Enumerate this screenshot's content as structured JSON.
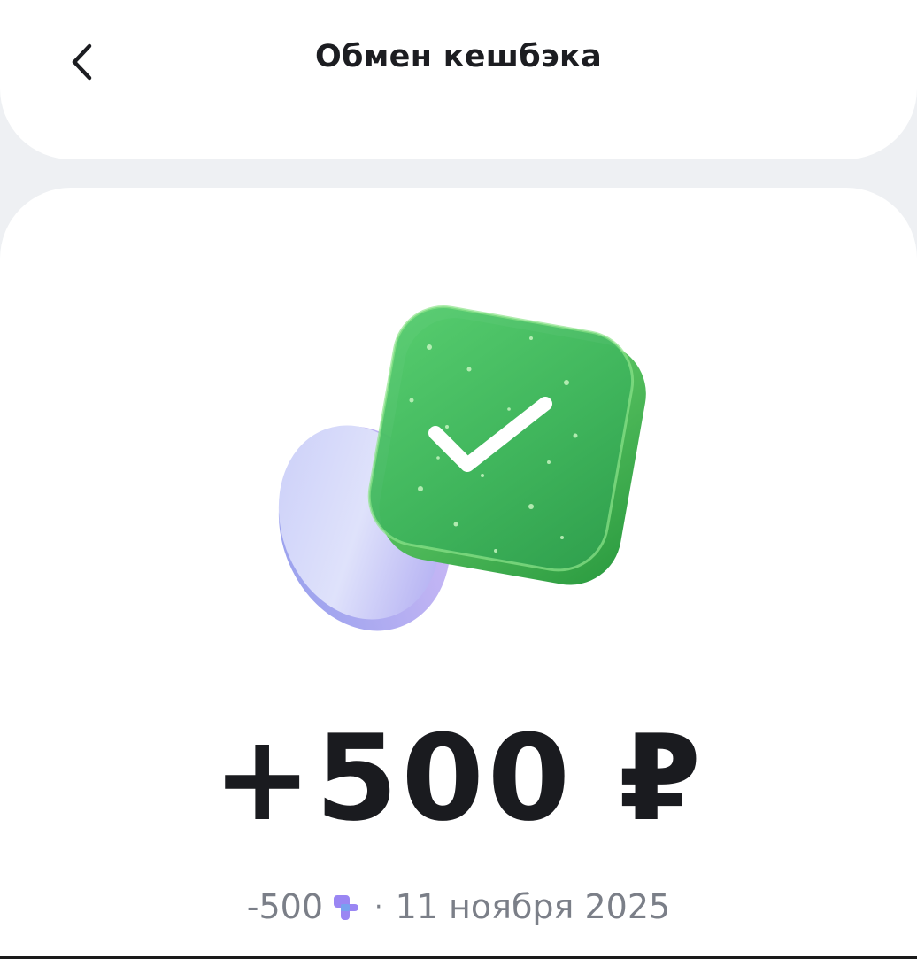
{
  "header": {
    "title": "Обмен кешбэка",
    "back_icon": "chevron-left-icon"
  },
  "illustration": {
    "icon": "success-check-badge-icon",
    "badge_color": "#3dbb5a",
    "coin_color": "#b8bdf5"
  },
  "transaction": {
    "amount": "+500 ₽",
    "points": "-500",
    "points_icon": "cashback-points-icon",
    "points_icon_color": "#8e7cf2",
    "separator": "·",
    "date": "11 ноября 2025"
  }
}
